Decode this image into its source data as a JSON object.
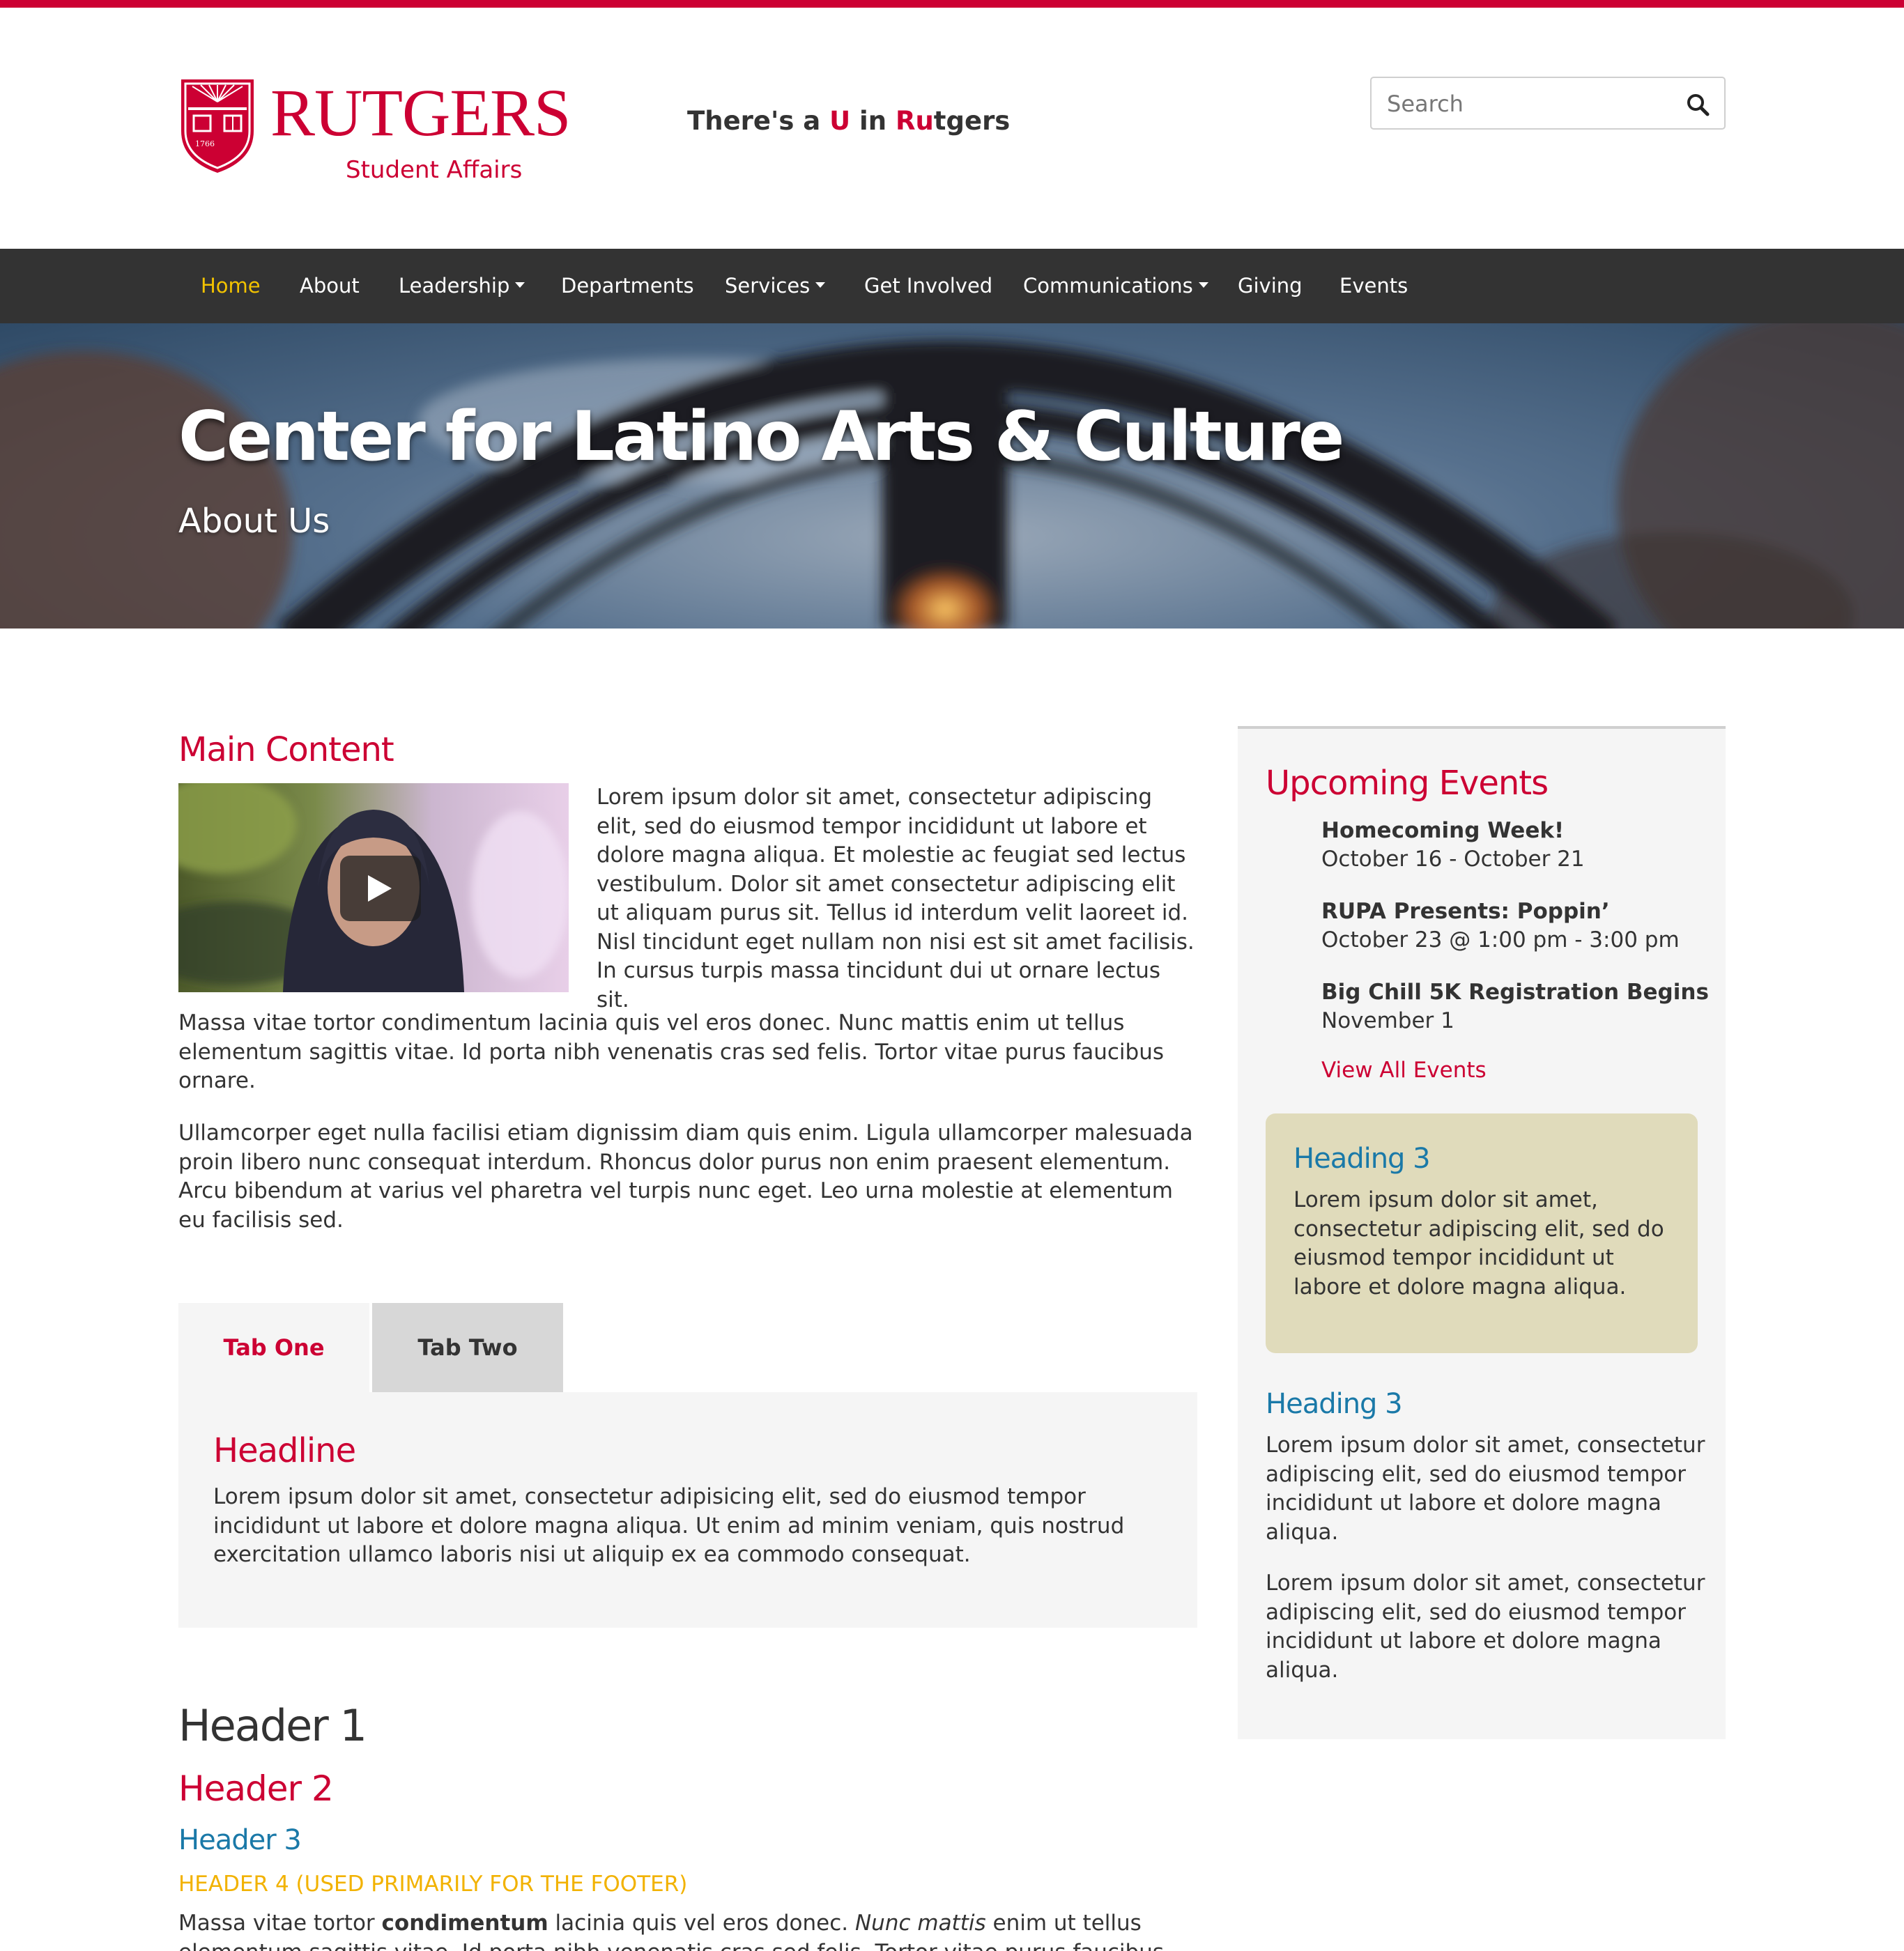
{
  "brand": {
    "logo_word": "RUTGERS",
    "logo_sub": "Student Affairs",
    "shield_year": "1766",
    "tagline_pre": "There's a ",
    "tagline_u": "U",
    "tagline_mid": " in ",
    "tagline_r": "Ru",
    "tagline_post": "tgers",
    "accent_color": "#cc0033"
  },
  "search": {
    "placeholder": "Search",
    "icon": "search-icon"
  },
  "nav": {
    "items": [
      {
        "label": "Home",
        "active": true
      },
      {
        "label": "About"
      },
      {
        "label": "Leadership",
        "dropdown": true
      },
      {
        "label": "Departments"
      },
      {
        "label": "Services",
        "dropdown": true
      },
      {
        "label": "Get Involved"
      },
      {
        "label": "Communications",
        "dropdown": true
      },
      {
        "label": "Giving"
      },
      {
        "label": "Events"
      }
    ]
  },
  "hero": {
    "title": "Center for Latino Arts & Culture",
    "subtitle": "About Us"
  },
  "main": {
    "heading": "Main Content",
    "video_icon": "play-icon",
    "p1": "Lorem ipsum dolor sit amet, consectetur adipiscing elit, sed do eiusmod tempor incididunt ut labore et dolore magna aliqua. Et molestie ac feugiat sed lectus vestibulum. Dolor sit amet consectetur adipiscing elit ut aliquam purus sit. Tellus id interdum velit laoreet id. Nisl tincidunt eget nullam non nisi est sit amet facilisis. In cursus turpis massa tincidunt dui ut ornare lectus sit.",
    "p2": "Massa vitae tortor condimentum lacinia quis vel eros donec. Nunc mattis enim ut tellus elementum sagittis vitae. Id porta nibh venenatis cras sed felis. Tortor vitae purus faucibus ornare.",
    "p3": "Ullamcorper eget nulla facilisi etiam dignissim diam quis enim. Ligula ullamcorper malesuada proin libero nunc consequat interdum. Rhoncus dolor purus non enim praesent elementum. Arcu bibendum at varius vel pharetra vel turpis nunc eget. Leo urna molestie at elementum eu facilisis sed."
  },
  "tabs": {
    "items": [
      {
        "label": "Tab One",
        "active": true
      },
      {
        "label": "Tab Two"
      }
    ],
    "panel_headline": "Headline",
    "panel_text": "Lorem ipsum dolor sit amet, consectetur adipisicing elit, sed do eiusmod tempor incididunt ut labore et dolore magna aliqua. Ut enim ad minim veniam, quis nostrud exercitation ullamco laboris nisi ut aliquip ex ea commodo consequat."
  },
  "typography": {
    "h1": "Header 1",
    "h2": "Header 2",
    "h3": "Header 3",
    "h4": "HEADER 4 (USED PRIMARILY FOR THE FOOTER)",
    "p_a": "Massa vitae tortor ",
    "p_bold": "condimentum",
    "p_b": " lacinia quis vel eros donec. ",
    "p_italic": "Nunc mattis",
    "p_c": " enim ut tellus elementum sagittis vitae. Id porta nibh venenatis cras sed felis. Tortor vitae purus faucibus"
  },
  "sidebar": {
    "title": "Upcoming Events",
    "events": [
      {
        "name": "Homecoming Week!",
        "date": "October 16 - October 21"
      },
      {
        "name": "RUPA Presents: Poppin’",
        "date": "October 23 @ 1:00 pm - 3:00 pm"
      },
      {
        "name": "Big Chill 5K Registration Begins",
        "date": "November 1"
      }
    ],
    "view_all": "View All Events",
    "callout_heading": "Heading 3",
    "callout_text": "Lorem ipsum dolor sit amet, consectetur adipiscing elit, sed do eiusmod tempor incididunt ut labore et dolore magna aliqua.",
    "h3": "Heading 3",
    "p1": "Lorem ipsum dolor sit amet, consectetur adipiscing elit, sed do eiusmod tempor incididunt ut labore et dolore magna aliqua.",
    "p2": "Lorem ipsum dolor sit amet, consectetur adipiscing elit, sed do eiusmod tempor incididunt ut labore et dolore magna aliqua."
  }
}
